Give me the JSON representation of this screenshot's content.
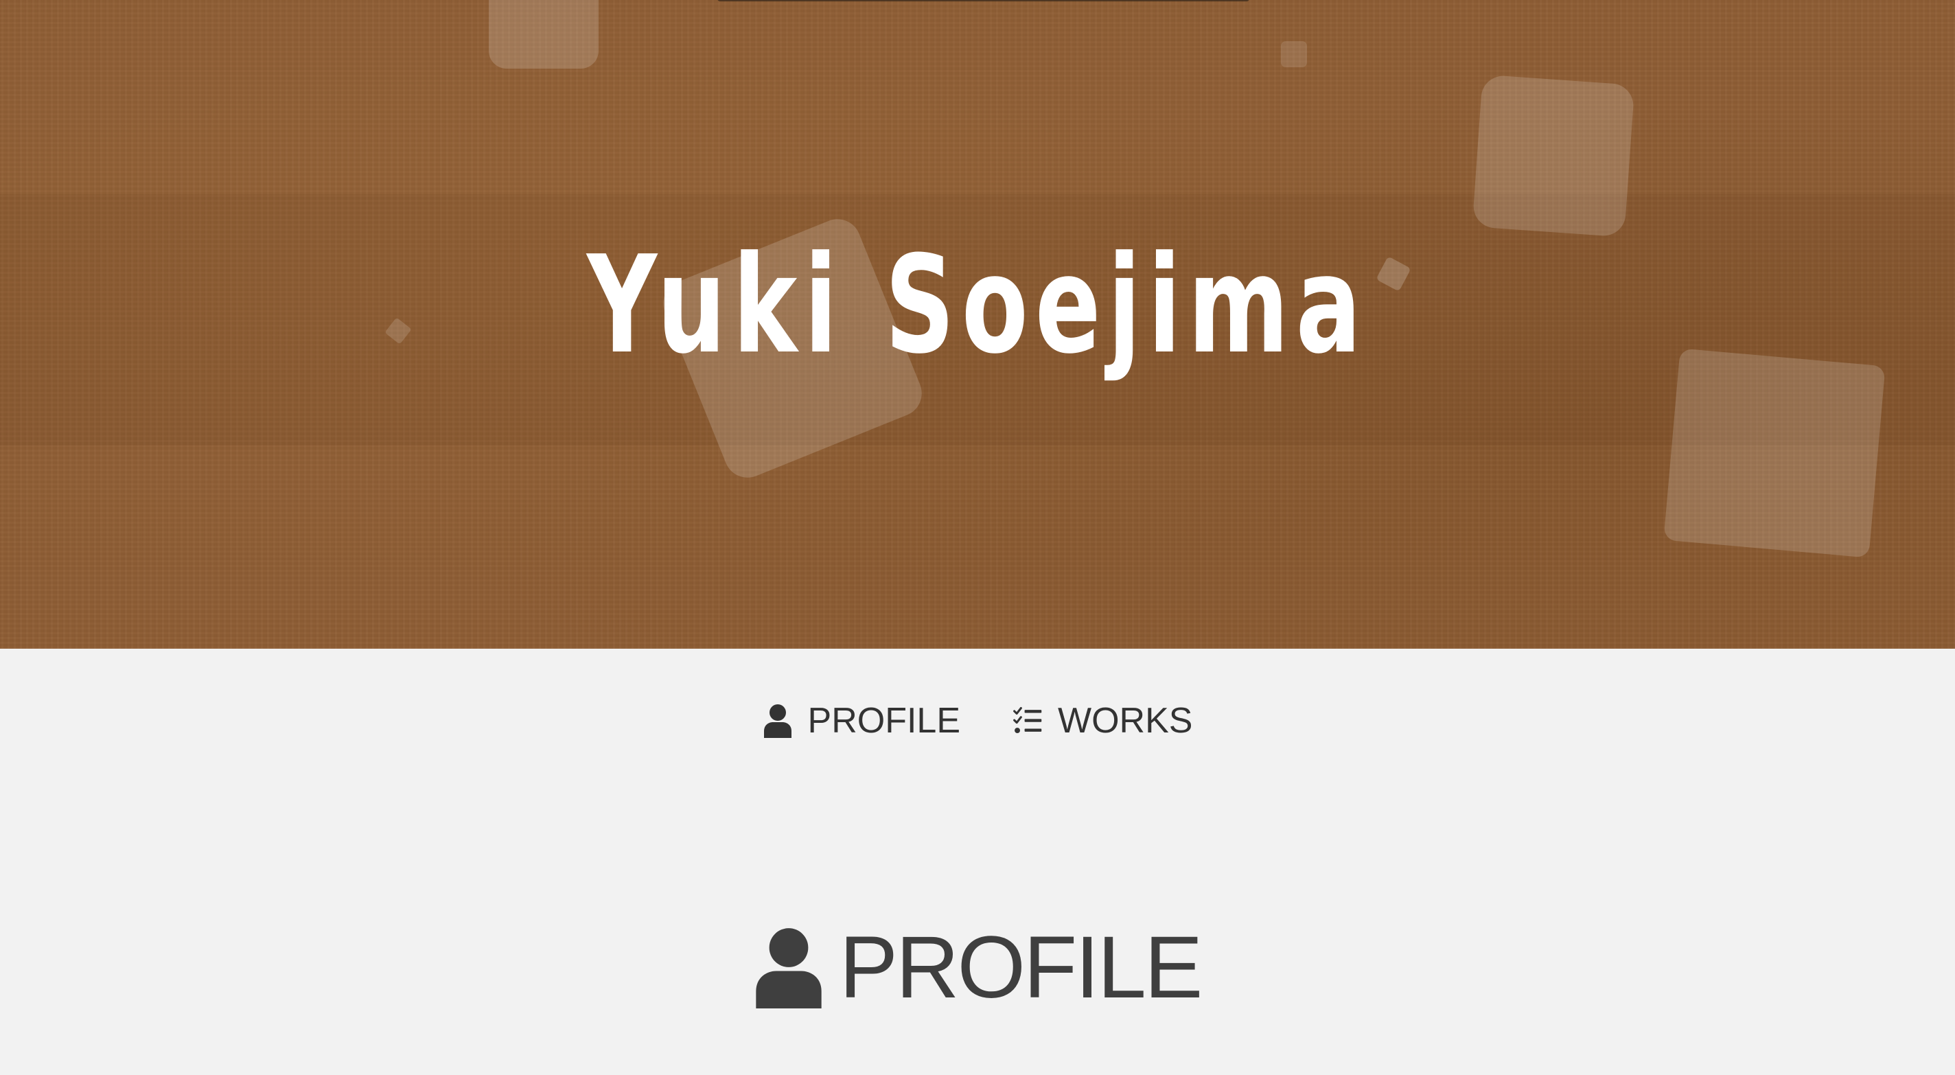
{
  "hero": {
    "title": "Yuki Soejima"
  },
  "nav": {
    "items": [
      {
        "label": "PROFILE",
        "icon": "user-icon"
      },
      {
        "label": "WORKS",
        "icon": "tasks-list-icon"
      }
    ]
  },
  "section": {
    "title": "PROFILE",
    "icon": "user-icon"
  },
  "colors": {
    "hero_background": "#8f5e35",
    "page_background": "#f2f2f2",
    "nav_text": "#333333",
    "heading_text": "#3f3f3f",
    "hero_title": "#ffffff"
  }
}
